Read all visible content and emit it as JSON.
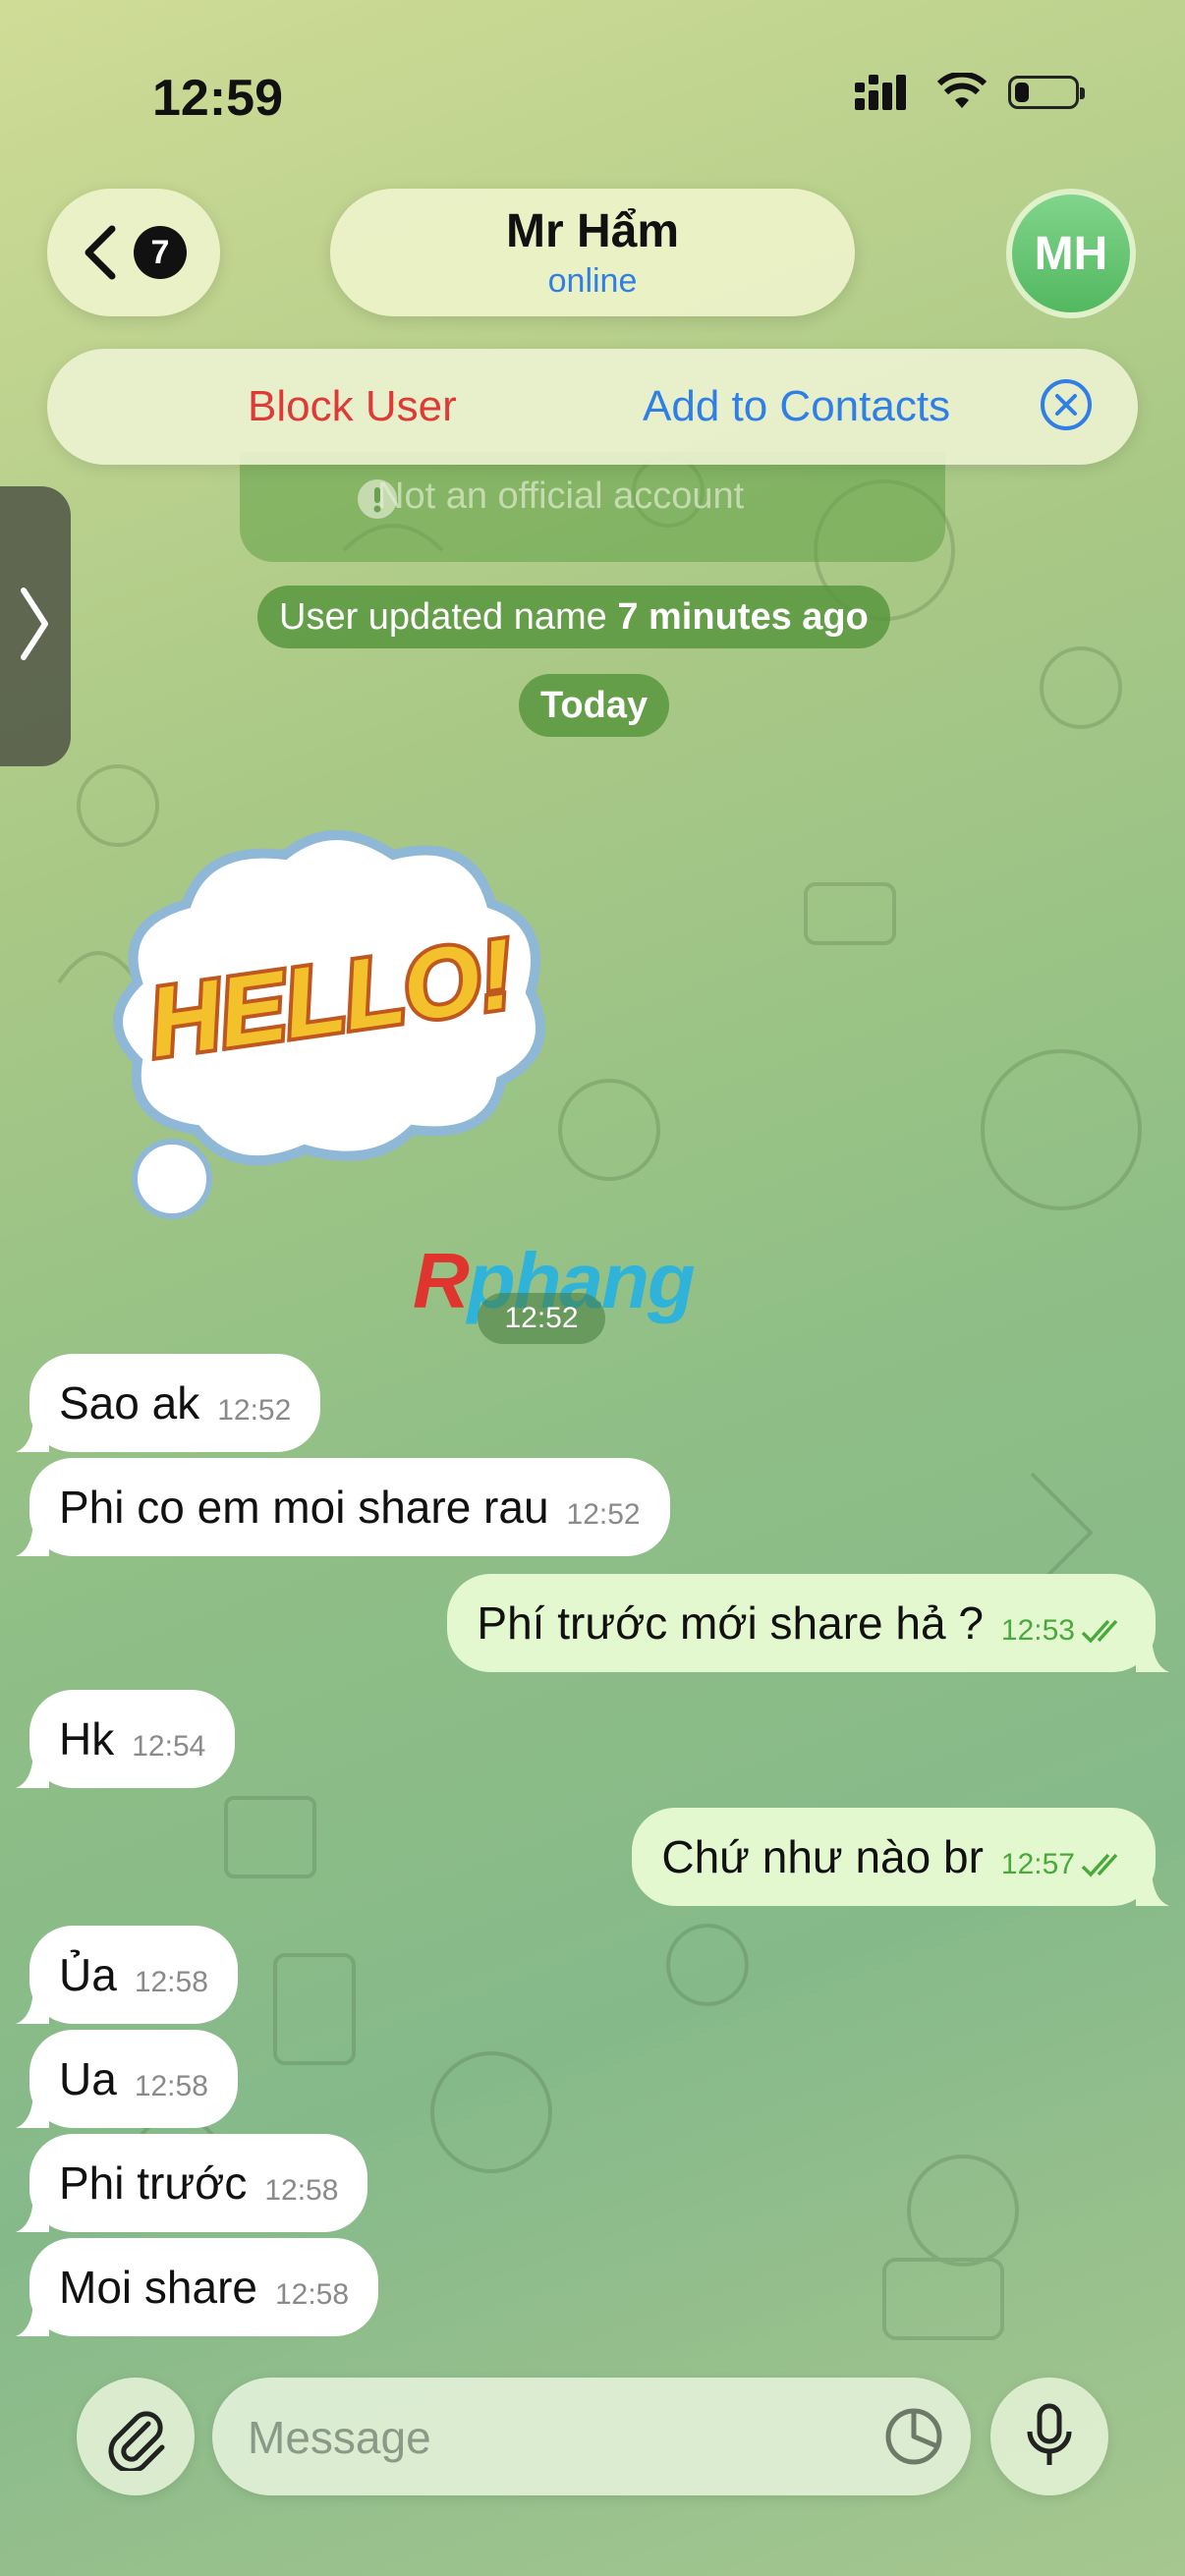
{
  "status_bar": {
    "time": "12:59"
  },
  "header": {
    "unread_count": "7",
    "contact_name": "Mr Hẩm",
    "contact_status": "online",
    "avatar_initials": "MH"
  },
  "actions": {
    "block_label": "Block User",
    "add_contacts_label": "Add to Contacts"
  },
  "card": {
    "notice": "Not an official account"
  },
  "system": {
    "name_update_prefix": "User updated name ",
    "name_update_time": "7 minutes ago",
    "date_divider": "Today"
  },
  "sticker": {
    "text": "HELLO!",
    "time": "12:52"
  },
  "watermark": {
    "first": "R",
    "rest": "phang"
  },
  "messages": [
    {
      "dir": "in",
      "text": "Sao ak",
      "time": "12:52"
    },
    {
      "dir": "in",
      "text": "Phi co em moi share rau",
      "time": "12:52"
    },
    {
      "dir": "out",
      "text": "Phí trước mới share hả ?",
      "time": "12:53"
    },
    {
      "dir": "in",
      "text": "Hk",
      "time": "12:54"
    },
    {
      "dir": "out",
      "text": "Chứ như nào br",
      "time": "12:57"
    },
    {
      "dir": "in",
      "text": "Ủa",
      "time": "12:58"
    },
    {
      "dir": "in",
      "text": "Ua",
      "time": "12:58"
    },
    {
      "dir": "in",
      "text": "Phi trước",
      "time": "12:58"
    },
    {
      "dir": "in",
      "text": "Moi share",
      "time": "12:58"
    }
  ],
  "composer": {
    "placeholder": "Message"
  },
  "colors": {
    "accent": "#2f7fe6",
    "danger": "#de3b36",
    "outgoing_bubble": "#e4f8cf",
    "read_check": "#4aa83d"
  }
}
